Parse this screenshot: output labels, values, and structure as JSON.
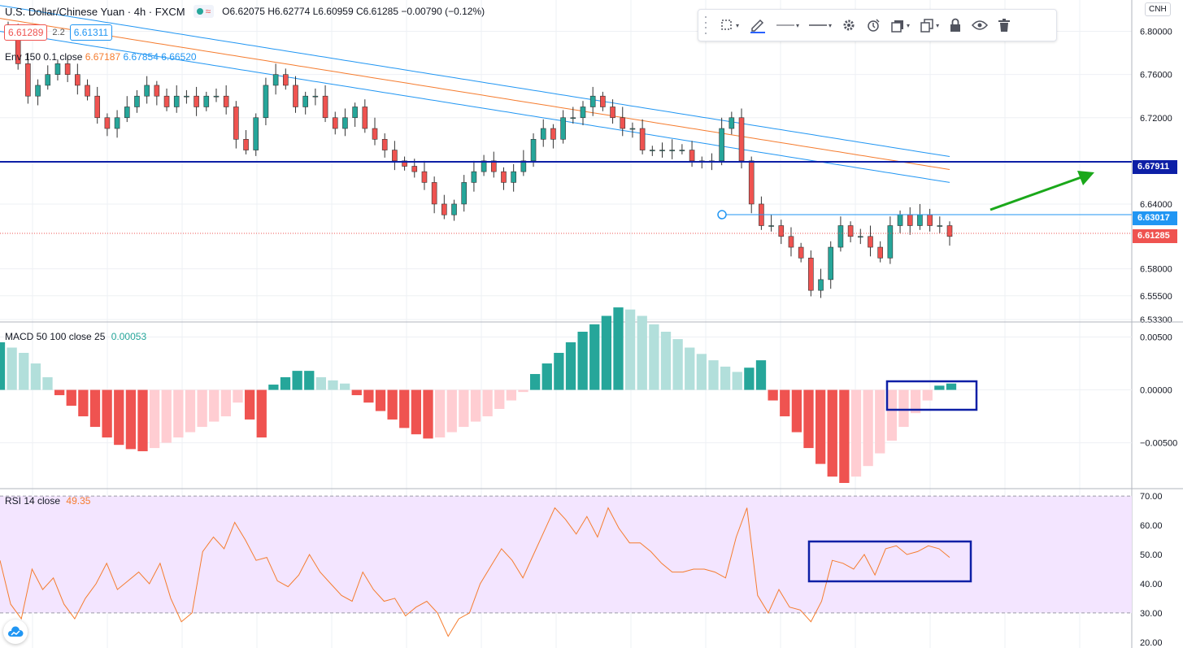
{
  "header": {
    "symbol": "U.S. Dollar/Chinese Yuan · 4h · FXCM",
    "ohlc": "O6.62075 H6.62774 L6.60959 C6.61285 −0.00790 (−0.12%)",
    "wave_glyph": "≈"
  },
  "trade": {
    "sell_price": "6.61289",
    "spread": "2.2",
    "buy_price": "6.61311"
  },
  "ema_legend": {
    "label": "Env 150 0.1 close",
    "v1": "6.67187",
    "v2": "6.67854",
    "v3": "6.66520"
  },
  "macd_legend": {
    "label": "MACD 50 100 close 25",
    "value": "0.00053"
  },
  "rsi_legend": {
    "label": "RSI 14 close",
    "value": "49.35"
  },
  "currency_code": "CNH",
  "toolbar": {
    "icons": [
      "grip-icon",
      "select-area-icon",
      "pencil-icon",
      "line-style-icon",
      "line-width-icon",
      "settings-icon",
      "alert-icon",
      "fill-icon",
      "clone-icon",
      "lock-icon",
      "eye-icon",
      "trash-icon"
    ]
  },
  "colors": {
    "up": "#26a69a",
    "down": "#ef5350",
    "ema": "#f57c2f",
    "band": "#2196f3",
    "hline": "#0d1fa6",
    "arrow": "#1aa81a",
    "rsi_line": "#f57c2f",
    "rsi_bg": "#f3e5ff",
    "macd_up_strong": "#26a69a",
    "macd_up_weak": "#b2dfdb",
    "macd_dn_strong": "#ef5350",
    "macd_dn_weak": "#ffcdd2"
  },
  "price_axis": {
    "ticks": [
      "6.80000",
      "6.76000",
      "6.72000",
      "6.64000",
      "6.58000",
      "6.55500",
      "6.53300"
    ],
    "tag_hline": "6.67911",
    "tag_level": "6.63017",
    "tag_last": "6.61285"
  },
  "macd_axis": {
    "ticks": [
      "0.00500",
      "0.00000",
      "−0.00500"
    ]
  },
  "rsi_axis": {
    "ticks": [
      "70.00",
      "60.00",
      "50.00",
      "40.00",
      "30.00",
      "20.00"
    ]
  },
  "chart_data": {
    "type": "candlestick",
    "title": "U.S. Dollar/Chinese Yuan · 4h · FXCM",
    "price_ylim": [
      6.533,
      6.82
    ],
    "horizontal_levels": [
      6.67911,
      6.63017
    ],
    "last_price": 6.61285,
    "closes": [
      6.8,
      6.77,
      6.74,
      6.75,
      6.76,
      6.77,
      6.76,
      6.75,
      6.74,
      6.72,
      6.71,
      6.72,
      6.73,
      6.74,
      6.75,
      6.74,
      6.73,
      6.74,
      6.74,
      6.73,
      6.74,
      6.74,
      6.73,
      6.7,
      6.69,
      6.72,
      6.75,
      6.76,
      6.75,
      6.73,
      6.74,
      6.74,
      6.72,
      6.71,
      6.72,
      6.73,
      6.71,
      6.7,
      6.69,
      6.68,
      6.675,
      6.67,
      6.66,
      6.64,
      6.63,
      6.64,
      6.66,
      6.67,
      6.68,
      6.67,
      6.66,
      6.67,
      6.68,
      6.7,
      6.71,
      6.7,
      6.72,
      6.72,
      6.73,
      6.74,
      6.73,
      6.72,
      6.71,
      6.71,
      6.69,
      6.69,
      6.69,
      6.69,
      6.69,
      6.68,
      6.68,
      6.68,
      6.71,
      6.72,
      6.68,
      6.64,
      6.62,
      6.62,
      6.61,
      6.6,
      6.59,
      6.56,
      6.57,
      6.6,
      6.62,
      6.61,
      6.61,
      6.6,
      6.59,
      6.62,
      6.63,
      6.62,
      6.63,
      6.62,
      6.62,
      6.61
    ],
    "macd_ylim": [
      -0.0088,
      0.0055
    ],
    "macd_hist": [
      0.0045,
      0.004,
      0.0035,
      0.0025,
      0.0012,
      -0.0005,
      -0.0015,
      -0.0025,
      -0.0035,
      -0.0045,
      -0.0052,
      -0.0056,
      -0.0058,
      -0.0055,
      -0.005,
      -0.0045,
      -0.004,
      -0.0035,
      -0.003,
      -0.0025,
      -0.0012,
      -0.0028,
      -0.0045,
      0.0005,
      0.0012,
      0.0018,
      0.0018,
      0.0012,
      0.0009,
      0.0006,
      -0.0005,
      -0.0012,
      -0.002,
      -0.0028,
      -0.0036,
      -0.0042,
      -0.0046,
      -0.0045,
      -0.004,
      -0.0035,
      -0.003,
      -0.0025,
      -0.0018,
      -0.001,
      -0.0002,
      0.0015,
      0.0025,
      0.0035,
      0.0045,
      0.0055,
      0.0062,
      0.007,
      0.0078,
      0.0076,
      0.007,
      0.0062,
      0.0055,
      0.0048,
      0.004,
      0.0034,
      0.0028,
      0.0022,
      0.0017,
      0.0021,
      0.0028,
      -0.001,
      -0.0025,
      -0.004,
      -0.0055,
      -0.007,
      -0.0082,
      -0.0088,
      -0.0082,
      -0.0072,
      -0.006,
      -0.0048,
      -0.0035,
      -0.0022,
      -0.001,
      0.0004,
      0.0006
    ],
    "rsi_ylim": [
      20,
      70
    ],
    "rsi_bands": [
      30,
      70
    ],
    "rsi": [
      48,
      33,
      28,
      45,
      38,
      42,
      33,
      28,
      35,
      40,
      47,
      38,
      41,
      44,
      40,
      47,
      35,
      27,
      30,
      51,
      56,
      52,
      61,
      55,
      48,
      49,
      41,
      39,
      43,
      50,
      44,
      40,
      36,
      34,
      44,
      38,
      34,
      35,
      29,
      32,
      34,
      30,
      22,
      28,
      30,
      40,
      46,
      52,
      48,
      42,
      50,
      58,
      66,
      62,
      57,
      63,
      56,
      66,
      59,
      54,
      54,
      51,
      47,
      44,
      44,
      45,
      45,
      44,
      42,
      56,
      66,
      36,
      30,
      38,
      32,
      31,
      27,
      34,
      48,
      47,
      45,
      50,
      43,
      52,
      53,
      50,
      51,
      53,
      52,
      49
    ]
  }
}
